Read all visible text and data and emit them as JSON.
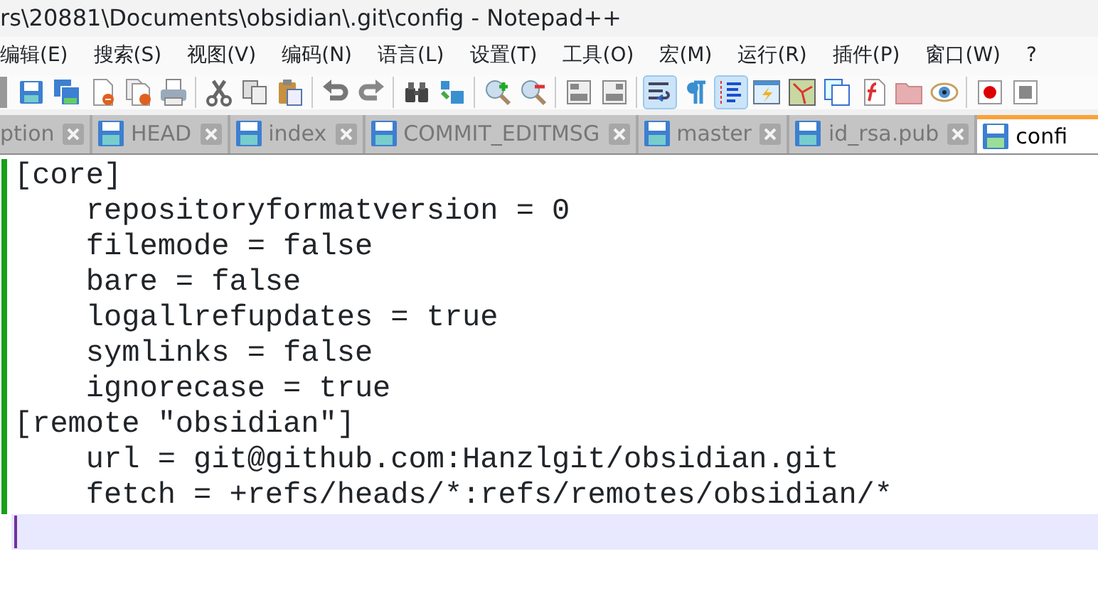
{
  "window": {
    "title": "rs\\20881\\Documents\\obsidian\\.git\\config - Notepad++"
  },
  "menu": [
    "编辑(E)",
    "搜索(S)",
    "视图(V)",
    "编码(N)",
    "语言(L)",
    "设置(T)",
    "工具(O)",
    "宏(M)",
    "运行(R)",
    "插件(P)",
    "窗口(W)",
    "?"
  ],
  "toolbar": [
    {
      "kind": "save",
      "pressed": false
    },
    {
      "kind": "saveall",
      "pressed": false
    },
    {
      "kind": "close",
      "pressed": false
    },
    {
      "kind": "closeall",
      "pressed": false
    },
    {
      "kind": "print",
      "pressed": false
    },
    {
      "kind": "sep"
    },
    {
      "kind": "cut",
      "pressed": false
    },
    {
      "kind": "copy",
      "pressed": false
    },
    {
      "kind": "paste",
      "pressed": false
    },
    {
      "kind": "sep"
    },
    {
      "kind": "undo",
      "pressed": false
    },
    {
      "kind": "redo",
      "pressed": false
    },
    {
      "kind": "sep"
    },
    {
      "kind": "find",
      "pressed": false
    },
    {
      "kind": "replace",
      "pressed": false
    },
    {
      "kind": "sep"
    },
    {
      "kind": "zoomin",
      "pressed": false
    },
    {
      "kind": "zoomout",
      "pressed": false
    },
    {
      "kind": "sep"
    },
    {
      "kind": "syncv",
      "pressed": false
    },
    {
      "kind": "synch",
      "pressed": false
    },
    {
      "kind": "sep"
    },
    {
      "kind": "wrap",
      "pressed": true
    },
    {
      "kind": "allchars",
      "pressed": false
    },
    {
      "kind": "indent",
      "pressed": true
    },
    {
      "kind": "udl",
      "pressed": false
    },
    {
      "kind": "map",
      "pressed": false
    },
    {
      "kind": "doclist",
      "pressed": false
    },
    {
      "kind": "funclist",
      "pressed": false
    },
    {
      "kind": "folder",
      "pressed": false
    },
    {
      "kind": "monitor",
      "pressed": false
    },
    {
      "kind": "sep"
    },
    {
      "kind": "record",
      "pressed": false
    },
    {
      "kind": "stop",
      "pressed": false
    }
  ],
  "tabs": [
    {
      "label": "ption",
      "selected": false
    },
    {
      "label": "HEAD",
      "selected": false,
      "saved": true
    },
    {
      "label": "index",
      "selected": false,
      "saved": true
    },
    {
      "label": "COMMIT_EDITMSG",
      "selected": false,
      "saved": true
    },
    {
      "label": "master",
      "selected": false,
      "saved": true
    },
    {
      "label": "id_rsa.pub",
      "selected": false,
      "saved": true
    },
    {
      "label": "confi",
      "selected": true,
      "saved": true
    }
  ],
  "editor": {
    "lines": [
      {
        "text": "[core]",
        "changed": true,
        "current": false
      },
      {
        "text": "    repositoryformatversion = 0",
        "changed": true,
        "current": false
      },
      {
        "text": "    filemode = false",
        "changed": true,
        "current": false
      },
      {
        "text": "    bare = false",
        "changed": true,
        "current": false
      },
      {
        "text": "    logallrefupdates = true",
        "changed": true,
        "current": false
      },
      {
        "text": "    symlinks = false",
        "changed": true,
        "current": false
      },
      {
        "text": "    ignorecase = true",
        "changed": true,
        "current": false
      },
      {
        "text": "[remote \"obsidian\"]",
        "changed": true,
        "current": false
      },
      {
        "text": "    url = git@github.com:Hanzlgit/obsidian.git",
        "changed": true,
        "current": false
      },
      {
        "text": "    fetch = +refs/heads/*:refs/remotes/obsidian/*",
        "changed": true,
        "current": false
      },
      {
        "changed": false,
        "current": true
      }
    ]
  }
}
